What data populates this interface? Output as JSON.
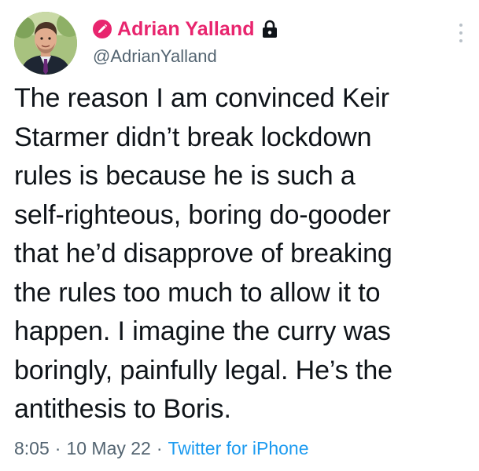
{
  "author": {
    "display_name": "Adrian Yalland",
    "handle": "@AdrianYalland",
    "badge_icon": "pink-circle-pencil-icon",
    "protected_icon": "lock-icon",
    "name_color": "#e8256e"
  },
  "tweet": {
    "text": "The reason I am convinced Keir\nStarmer didn’t break lockdown\nrules is because he is such a\nself-righteous, boring do-gooder\nthat he’d disapprove of breaking\nthe rules too much to allow it to\nhappen. I imagine the curry was\nboringly, painfully legal. He’s the\nantithesis to Boris."
  },
  "meta": {
    "time": "8:05",
    "separator": "·",
    "date": "10 May 22",
    "source": "Twitter for iPhone",
    "source_color": "#1d9bf0"
  },
  "menu": {
    "icon": "more-vertical-icon"
  }
}
